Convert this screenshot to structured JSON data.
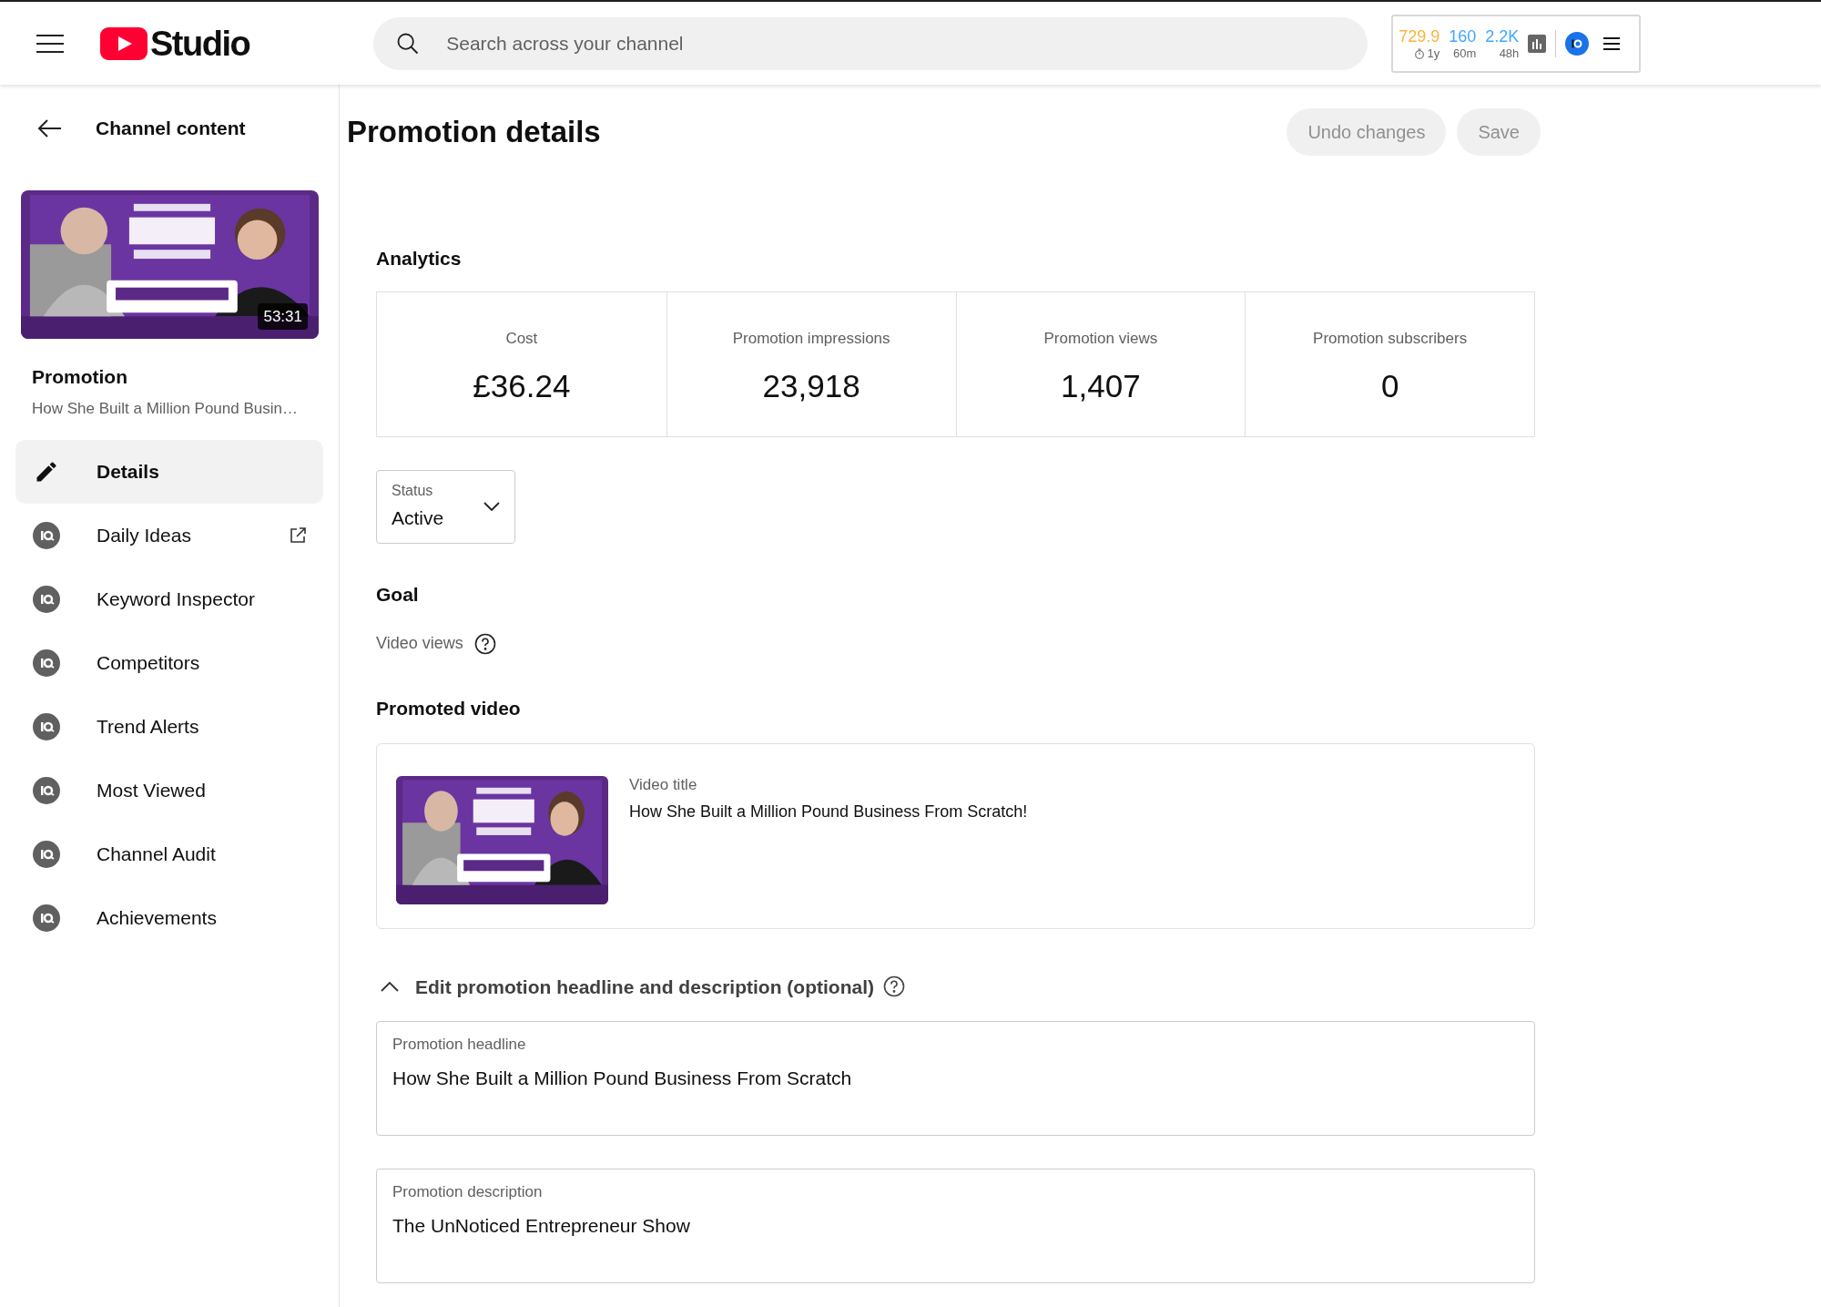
{
  "header": {
    "logo": "Studio",
    "search": {
      "placeholder": "Search across your channel"
    },
    "stats": [
      {
        "value": "729.9",
        "period": "1y",
        "color": "#f9b43a",
        "kind": "timer"
      },
      {
        "value": "160",
        "period": "60m",
        "color": "#3ea6ff",
        "kind": "plain"
      },
      {
        "value": "2.2K",
        "period": "48h",
        "color": "#3ea6ff",
        "kind": "plain"
      }
    ]
  },
  "sidebar": {
    "back_label": "Channel content",
    "video": {
      "duration": "53:31",
      "section": "Promotion",
      "title": "How She Built a Million Pound Busin…"
    },
    "items": [
      {
        "label": "Details",
        "kind": "edit",
        "selected": true,
        "external": false
      },
      {
        "label": "Daily Ideas",
        "kind": "tool",
        "selected": false,
        "external": true
      },
      {
        "label": "Keyword Inspector",
        "kind": "tool",
        "selected": false,
        "external": false
      },
      {
        "label": "Competitors",
        "kind": "tool",
        "selected": false,
        "external": false
      },
      {
        "label": "Trend Alerts",
        "kind": "tool",
        "selected": false,
        "external": false
      },
      {
        "label": "Most Viewed",
        "kind": "tool",
        "selected": false,
        "external": false
      },
      {
        "label": "Channel Audit",
        "kind": "tool",
        "selected": false,
        "external": false
      },
      {
        "label": "Achievements",
        "kind": "tool",
        "selected": false,
        "external": false
      }
    ]
  },
  "main": {
    "title": "Promotion details",
    "buttons": [
      {
        "label": "Undo changes",
        "disabled": true
      },
      {
        "label": "Save",
        "disabled": true
      }
    ],
    "analytics": {
      "heading": "Analytics",
      "metrics": [
        {
          "label": "Cost",
          "value": "£36.24"
        },
        {
          "label": "Promotion impressions",
          "value": "23,918"
        },
        {
          "label": "Promotion views",
          "value": "1,407"
        },
        {
          "label": "Promotion subscribers",
          "value": "0"
        }
      ]
    },
    "status": {
      "label": "Status",
      "value": "Active"
    },
    "goal": {
      "heading": "Goal",
      "value": "Video views"
    },
    "promoted_video": {
      "heading": "Promoted video",
      "field_label": "Video title",
      "title": "How She Built a Million Pound Business From Scratch!"
    },
    "edit_section": {
      "label": "Edit promotion headline and description (optional)",
      "expanded": true
    },
    "fields": [
      {
        "label": "Promotion headline",
        "value": "How She Built a Million Pound Business From Scratch"
      },
      {
        "label": "Promotion description",
        "value": "The UnNoticed Entrepreneur Show"
      }
    ]
  }
}
